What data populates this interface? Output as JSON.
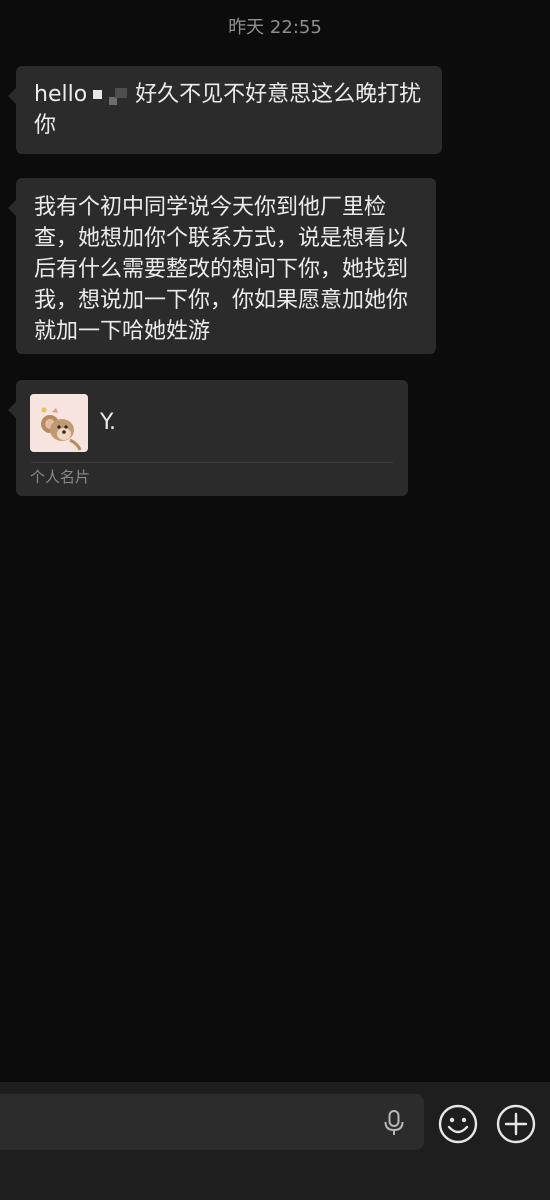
{
  "chat": {
    "timestamp": "昨天 22:55",
    "messages": [
      {
        "type": "text",
        "prefix": "hello",
        "text": "好久不见不好意思这么晚打扰你"
      },
      {
        "type": "text",
        "text": "我有个初中同学说今天你到他厂里检查，她想加你个联系方式，说是想看以后有什么需要整改的想问下你，她找到我，想说加一下你，你如果愿意加她你就加一下哈她姓游"
      },
      {
        "type": "contact-card",
        "name": "Y.",
        "label": "个人名片"
      }
    ]
  },
  "input_bar": {
    "value": "",
    "icons": [
      "microphone-icon",
      "emoji-icon",
      "plus-icon"
    ]
  },
  "colors": {
    "background": "#0c0c0c",
    "bubble": "#2b2b2b",
    "text": "#ececec",
    "muted": "#8f8f8f"
  }
}
